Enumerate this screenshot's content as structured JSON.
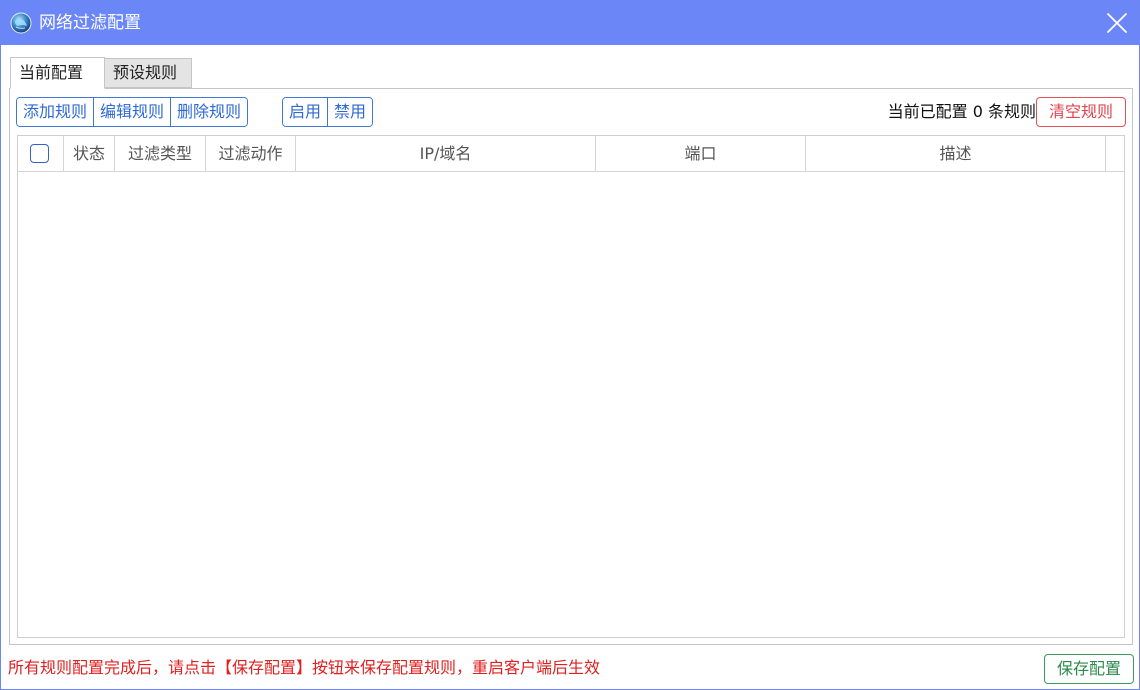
{
  "window": {
    "title": "网络过滤配置",
    "app_icon": "globe-icon",
    "close_icon": "close-icon"
  },
  "tabs": [
    {
      "label": "当前配置",
      "active": true
    },
    {
      "label": "预设规则",
      "active": false
    }
  ],
  "toolbar": {
    "add_label": "添加规则",
    "edit_label": "编辑规则",
    "delete_label": "删除规则",
    "enable_label": "启用",
    "disable_label": "禁用",
    "count_text": "当前已配置 0 条规则",
    "clear_label": "清空规则"
  },
  "table": {
    "columns": [
      "状态",
      "过滤类型",
      "过滤动作",
      "IP/域名",
      "端口",
      "描述"
    ],
    "rows": []
  },
  "footer": {
    "note": "所有规则配置完成后，请点击【保存配置】按钮来保存配置规则，重启客户端后生效",
    "save_label": "保存配置"
  },
  "colors": {
    "titlebar": "#6b87f7",
    "primary_button": "#3f78d8",
    "danger": "#e0444d",
    "success": "#2b8a4a",
    "note_text": "#e02020"
  }
}
